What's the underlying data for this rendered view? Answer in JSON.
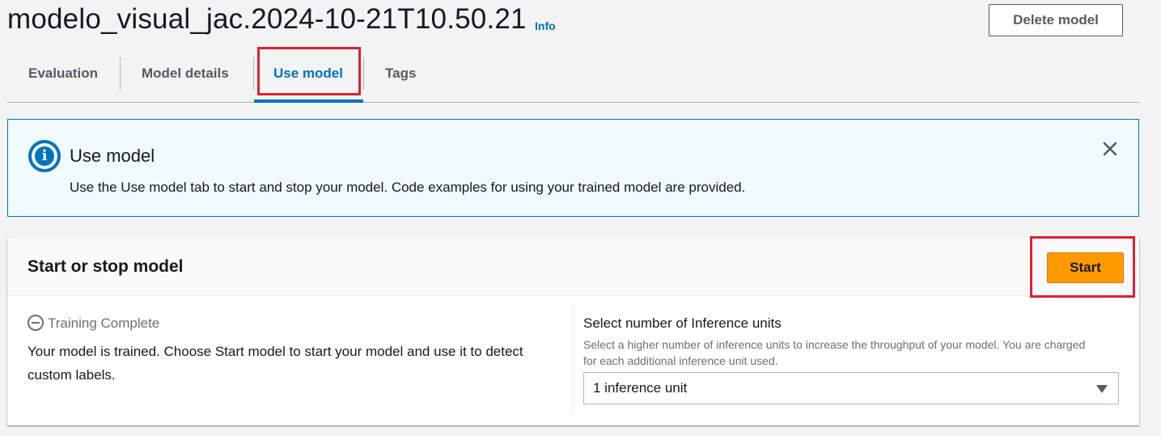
{
  "header": {
    "title": "modelo_visual_jac.2024-10-21T10.50.21",
    "info_link": "Info",
    "delete_button": "Delete model"
  },
  "tabs": [
    {
      "label": "Evaluation",
      "active": false
    },
    {
      "label": "Model details",
      "active": false
    },
    {
      "label": "Use model",
      "active": true
    },
    {
      "label": "Tags",
      "active": false
    }
  ],
  "flash": {
    "icon": "info-icon",
    "title": "Use model",
    "body": "Use the Use model tab to start and stop your model. Code examples for using your trained model are provided.",
    "close_icon": "close-icon"
  },
  "model_panel": {
    "title": "Start or stop model",
    "start_button": "Start",
    "status": "Training Complete",
    "status_icon": "status-stopped-icon",
    "status_description": "Your model is trained. Choose Start model to start your model and use it to detect custom labels.",
    "inference": {
      "label": "Select number of Inference units",
      "description": "Select a higher number of inference units to increase the throughput of your model. You are charged for each additional inference unit used.",
      "selected": "1 inference unit"
    }
  },
  "colors": {
    "accent": "#0073bb",
    "primary_button": "#ff9900",
    "highlight_box": "#e02131",
    "flash_background": "#f1faff"
  }
}
